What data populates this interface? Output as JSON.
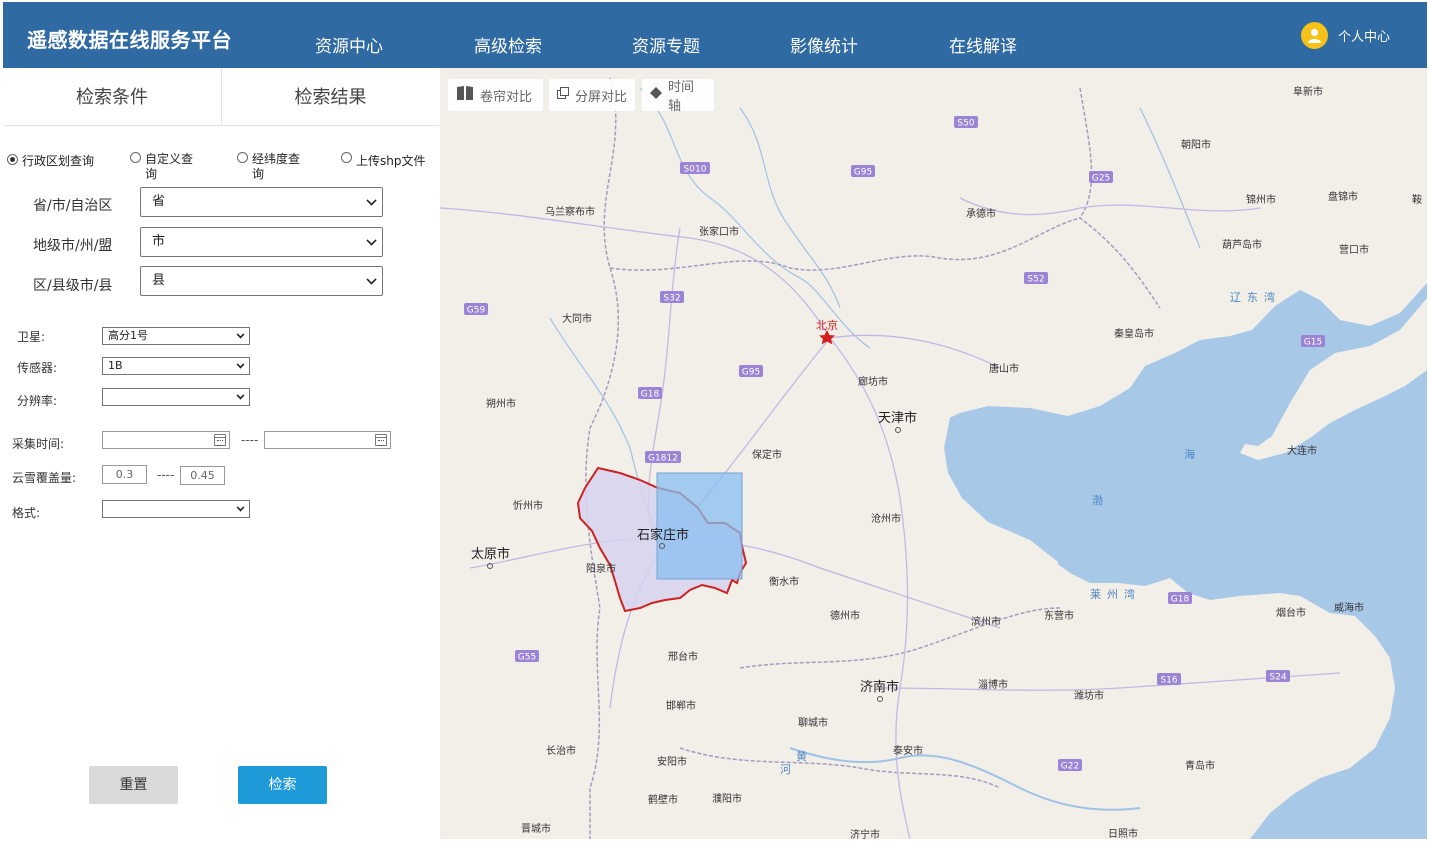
{
  "header": {
    "brand": "遥感数据在线服务平台",
    "nav": [
      "资源中心",
      "高级检索",
      "资源专题",
      "影像统计",
      "在线解译"
    ],
    "user_label": "个人中心"
  },
  "tabs": [
    "检索条件",
    "检索结果"
  ],
  "query_modes": {
    "options": [
      {
        "line1": "行政区划查询",
        "line2": ""
      },
      {
        "line1": "自定义查",
        "line2": "询"
      },
      {
        "line1": "经纬度查",
        "line2": "询"
      },
      {
        "line1": "上传shp文件",
        "line2": ""
      }
    ],
    "selected_index": 0
  },
  "region": {
    "province": {
      "label": "省/市/自治区",
      "value": "省"
    },
    "city": {
      "label": "地级市/州/盟",
      "value": "市"
    },
    "county": {
      "label": "区/县级市/县",
      "value": "县"
    }
  },
  "filters": {
    "satellite": {
      "label": "卫星:",
      "value": "高分1号"
    },
    "sensor": {
      "label": "传感器:",
      "value": "1B"
    },
    "resolution": {
      "label": "分辨率:",
      "value": ""
    },
    "time": {
      "label": "采集时间:",
      "start": "",
      "end": "",
      "separator": "----"
    },
    "cloud": {
      "label": "云雪覆盖量:",
      "min": "0.3",
      "max": "0.45",
      "separator": "----"
    },
    "format": {
      "label": "格式:",
      "value": ""
    }
  },
  "buttons": {
    "reset": "重置",
    "search": "检索"
  },
  "map": {
    "tools": [
      "卷帘对比",
      "分屏对比",
      "时间轴"
    ],
    "cities_major": [
      "北京",
      "天津市",
      "石家庄市",
      "太原市",
      "济南市"
    ],
    "cities_minor": [
      "阜新市",
      "朝阳市",
      "乌兰察布市",
      "承德市",
      "锦州市",
      "盘锦市",
      "张家口市",
      "葫芦岛市",
      "营口市",
      "大同市",
      "秦皇岛市",
      "廊坊市",
      "唐山市",
      "朔州市",
      "保定市",
      "大连市",
      "忻州市",
      "沧州市",
      "阳泉市",
      "衡水市",
      "德州市",
      "滨州市",
      "东营市",
      "烟台市",
      "威海市",
      "邢台市",
      "淄博市",
      "潍坊市",
      "邯郸市",
      "聊城市",
      "长治市",
      "泰安市",
      "安阳市",
      "青岛市",
      "鹤壁市",
      "濮阳市",
      "晋城市",
      "济宁市",
      "日照市",
      "鞍"
    ],
    "water_labels": [
      "辽东湾",
      "渤",
      "海",
      "莱州湾",
      "黄",
      "河"
    ],
    "highways": [
      "S50",
      "S010",
      "G95",
      "G25",
      "S32",
      "S52",
      "G59",
      "G95",
      "G18",
      "G15",
      "G1812",
      "G18",
      "G55",
      "S16",
      "S24",
      "G22"
    ],
    "colors": {
      "land": "#f2efe9",
      "sea": "#a8c8e8",
      "boundary": "#cc2222",
      "footprint_fill": "#88bff0",
      "region_fill": "#d7d2ef"
    }
  }
}
